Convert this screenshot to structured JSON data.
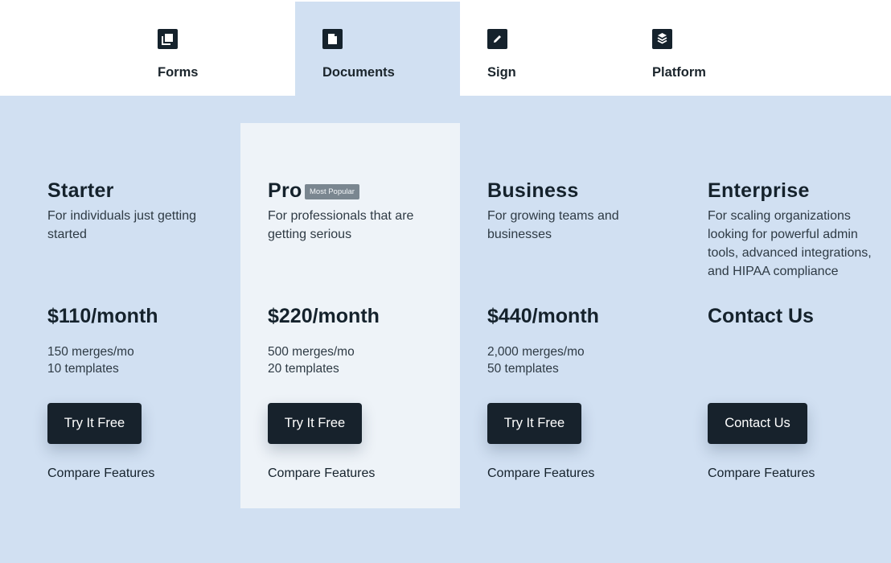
{
  "tabs": [
    {
      "label": "Forms",
      "icon": "forms-icon",
      "active": false
    },
    {
      "label": "Documents",
      "icon": "document-icon",
      "active": true
    },
    {
      "label": "Sign",
      "icon": "pencil-icon",
      "active": false
    },
    {
      "label": "Platform",
      "icon": "layers-icon",
      "active": false
    }
  ],
  "plans": [
    {
      "name": "Starter",
      "description": "For individuals just getting started",
      "price": "$110/month",
      "features": [
        "150 merges/mo",
        "10 templates"
      ],
      "cta": "Try It Free",
      "compare": "Compare Features"
    },
    {
      "name": "Pro",
      "badge": "Most Popular",
      "description": "For professionals that are getting serious",
      "price": "$220/month",
      "features": [
        "500 merges/mo",
        "20 templates"
      ],
      "cta": "Try It Free",
      "compare": "Compare Features"
    },
    {
      "name": "Business",
      "description": "For growing teams and businesses",
      "price": "$440/month",
      "features": [
        "2,000 merges/mo",
        "50 templates"
      ],
      "cta": "Try It Free",
      "compare": "Compare Features"
    },
    {
      "name": "Enterprise",
      "description": "For scaling organizations looking for powerful admin tools, advanced integrations, and HIPAA compliance",
      "price": "Contact Us",
      "features": [],
      "cta": "Contact Us",
      "compare": "Compare Features"
    }
  ],
  "colors": {
    "background": "#d1e0f2",
    "highlight_card": "#eef3f8",
    "button": "#17222c",
    "badge": "#7a8690"
  }
}
